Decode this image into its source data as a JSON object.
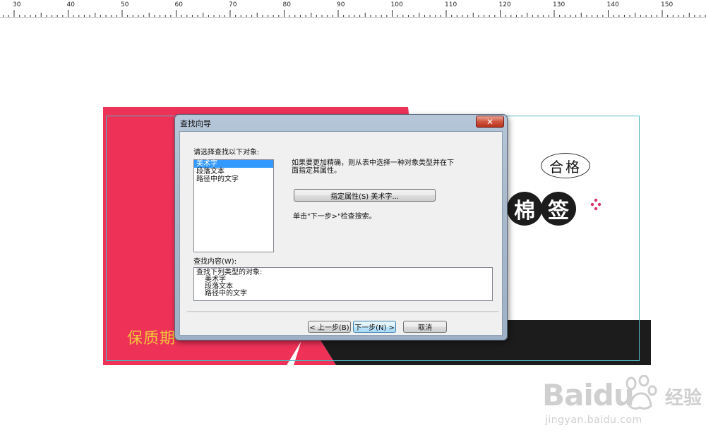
{
  "ruler": {
    "ticks": [
      "30",
      "40",
      "50",
      "60",
      "70",
      "80",
      "90",
      "100",
      "110",
      "120",
      "130",
      "140",
      "150"
    ]
  },
  "artwork": {
    "badge_text": "合格",
    "product_chars": [
      "棉",
      "签"
    ],
    "expiry_text": "保质期",
    "colors": {
      "red": "#ee3157",
      "black": "#1c1c1c",
      "expiry": "#f3c63c",
      "guide": "#4fb6c4"
    }
  },
  "dialog": {
    "title": "查找向导",
    "close_label": "✕",
    "select_label": "请选择查找以下对象:",
    "object_types": [
      {
        "label": "美术字",
        "selected": true
      },
      {
        "label": "段落文本",
        "selected": false
      },
      {
        "label": "路径中的文字",
        "selected": false
      }
    ],
    "description_line1": "如果要更加精确，则从表中选择一种对象类型并在下",
    "description_line2": "面指定其属性。",
    "properties_button": "指定属性(S) 美术字...",
    "hint": "单击\"下一步>\"检查搜索。",
    "content_label": "查找内容(W):",
    "content_header": "查找下列类型的对象:",
    "content_items": [
      "美术字",
      "段落文本",
      "路径中的文字"
    ],
    "back_button": "< 上一步(B)",
    "next_button": "下一步(N) >",
    "cancel_button": "取消"
  },
  "watermark": {
    "brand": "Baidu",
    "cn": "经验",
    "url": "jingyan.baidu.com"
  }
}
